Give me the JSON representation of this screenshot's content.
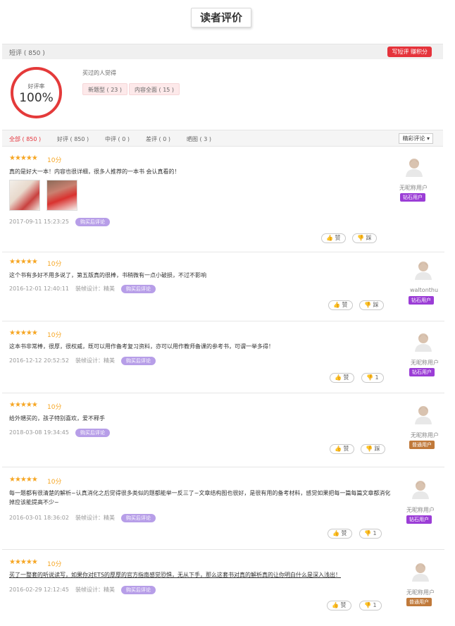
{
  "header": {
    "title": "读者评价"
  },
  "short_bar": {
    "label": "短评 ( 850 )",
    "write_button": "写短评 赚积分"
  },
  "summary": {
    "rating_label": "好评率",
    "rating_value": "100%",
    "buyers_text": "买过的人觉得",
    "tags": [
      "新题型 ( 23 )",
      "内容全面 ( 15 )"
    ]
  },
  "filters": {
    "tabs": [
      "全部 ( 850 )",
      "好评 ( 850 )",
      "中评 ( 0 )",
      "差评 ( 0 )",
      "晒图 ( 3 )"
    ],
    "active_tab": 0,
    "sort_label": "精彩评论"
  },
  "colors": {
    "accent": "#e5333b",
    "star": "#f6a623",
    "bought_badge": "#b79ee8",
    "diamond_badge": "#9b3dd6",
    "normal_badge": "#c0793a"
  },
  "reviews": [
    {
      "stars": "★★★★★",
      "score": "10分",
      "text": "真的是好大一本！内容也很详细，很多人推荐的一本书 会认真看的！",
      "date": "2017-09-11 15:23:25",
      "design": "",
      "bought": "购买后评论",
      "like": "赞",
      "dislike": "踩",
      "user": "无昵称用户",
      "badge": "钻石用户",
      "badge_type": "diamond"
    },
    {
      "stars": "★★★★★",
      "score": "10分",
      "text": "这个书有多好不用多说了，第五版真的很棒，书稍微有一点小破损，不过不影响",
      "date": "2016-12-01 12:40:11",
      "design": "装帧设计：精美",
      "bought": "购买后评论",
      "like": "赞",
      "dislike": "踩",
      "user": "waltonthu",
      "badge": "钻石用户",
      "badge_type": "diamond"
    },
    {
      "stars": "★★★★★",
      "score": "10分",
      "text": "这本书非常棒，很厚，很权威，既可以用作备考复习资料，亦可以用作教师备课的参考书，可谓一举多得！",
      "date": "2016-12-12 20:52:52",
      "design": "装帧设计：精美",
      "bought": "购买后评论",
      "like": "赞",
      "dislike": "1",
      "user": "无昵称用户",
      "badge": "钻石用户",
      "badge_type": "diamond"
    },
    {
      "stars": "★★★★★",
      "score": "10分",
      "text": "给外甥买的，孩子特别喜欢，爱不释手",
      "date": "2018-03-08 19:34:45",
      "design": "",
      "bought": "购买后评论",
      "like": "赞",
      "dislike": "踩",
      "user": "无昵称用户",
      "badge": "普通用户",
      "badge_type": "normal"
    },
    {
      "stars": "★★★★★",
      "score": "10分",
      "text": "每一题都有很清楚的解析~认真消化之后觉得很多类似的题都能举一反三了~文章结构图也很好，是很有用的备考材料，感觉如果把每一篇每篇文章都消化掉应该能提高不少~",
      "date": "2016-03-01 18:36:02",
      "design": "装帧设计：精美",
      "bought": "购买后评论",
      "like": "赞",
      "dislike": "1",
      "user": "无昵称用户",
      "badge": "钻石用户",
      "badge_type": "diamond"
    },
    {
      "stars": "★★★★★",
      "score": "10分",
      "text": "买了一整套的听说读写，如果你对ETS的厚厚的官方指南感觉恐惧，无从下手，那么这套书对真的解析真的让你明白什么是深入浅出！",
      "date": "2016-02-29 12:12:45",
      "design": "装帧设计：精美",
      "bought": "购买后评论",
      "like": "赞",
      "dislike": "1",
      "user": "无昵称用户",
      "badge": "普通用户",
      "badge_type": "normal"
    }
  ]
}
